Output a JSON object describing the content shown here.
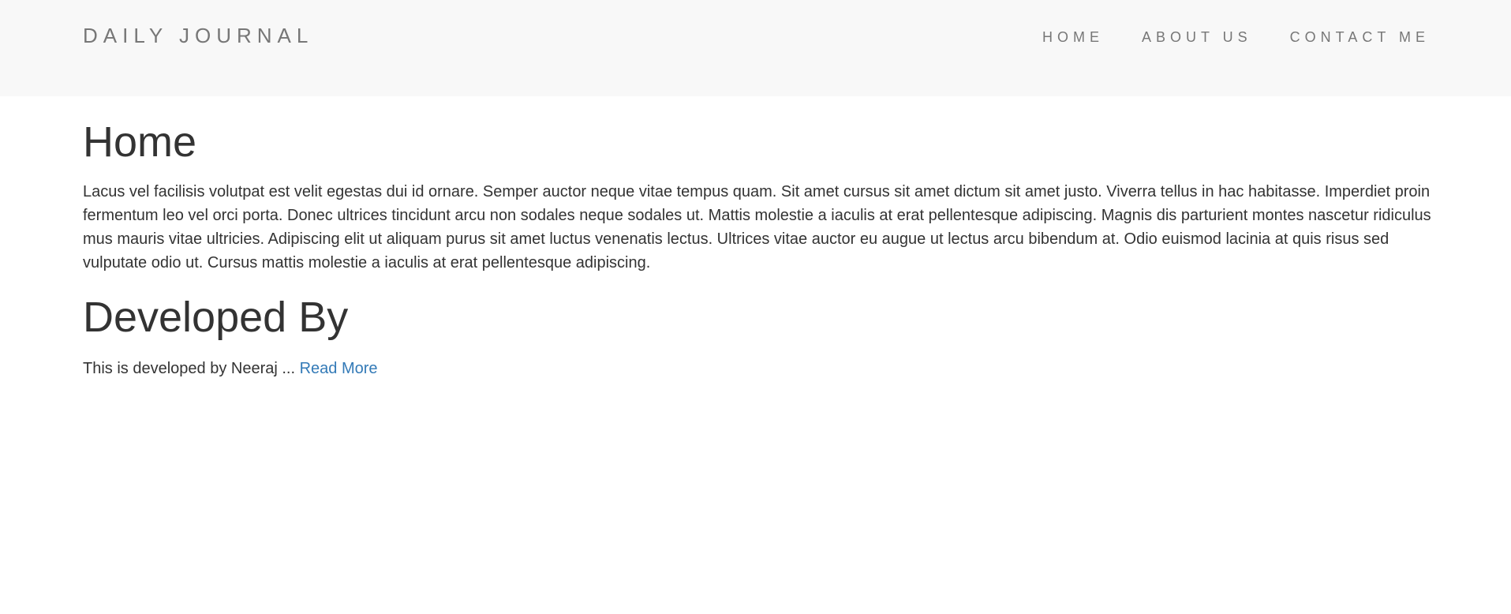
{
  "header": {
    "brand": "DAILY JOURNAL",
    "nav": [
      {
        "label": "HOME"
      },
      {
        "label": "ABOUT US"
      },
      {
        "label": "CONTACT ME"
      }
    ]
  },
  "main": {
    "home_title": "Home",
    "home_text": "Lacus vel facilisis volutpat est velit egestas dui id ornare. Semper auctor neque vitae tempus quam. Sit amet cursus sit amet dictum sit amet justo. Viverra tellus in hac habitasse. Imperdiet proin fermentum leo vel orci porta. Donec ultrices tincidunt arcu non sodales neque sodales ut. Mattis molestie a iaculis at erat pellentesque adipiscing. Magnis dis parturient montes nascetur ridiculus mus mauris vitae ultricies. Adipiscing elit ut aliquam purus sit amet luctus venenatis lectus. Ultrices vitae auctor eu augue ut lectus arcu bibendum at. Odio euismod lacinia at quis risus sed vulputate odio ut. Cursus mattis molestie a iaculis at erat pellentesque adipiscing.",
    "dev_title": "Developed By",
    "dev_text": "This is developed by Neeraj ... ",
    "read_more_label": "Read More"
  },
  "colors": {
    "navbar_bg": "#f8f8f8",
    "nav_text": "#777777",
    "body_text": "#333333",
    "link": "#337ab7"
  }
}
